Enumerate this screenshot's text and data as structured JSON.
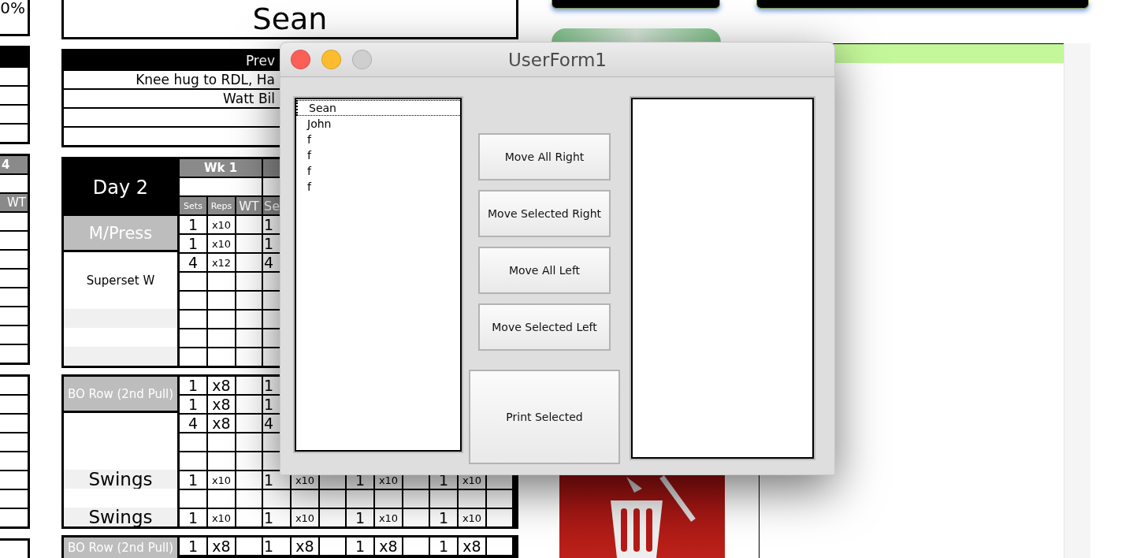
{
  "sheet": {
    "left": {
      "summary": "0%",
      "week_header": "4",
      "column": "WT"
    },
    "name_title": "Sean",
    "preview": {
      "header": "Prev",
      "lines": [
        "Knee hug to RDL, Ha",
        "Watt Bil"
      ]
    },
    "blocks": [
      {
        "header": {
          "title": "Day 2",
          "weeks": [
            "Wk 1"
          ],
          "columns": [
            "Sets",
            "Reps",
            "WT",
            "Se"
          ]
        },
        "labels": [
          {
            "kind": "exercise",
            "text": "M/Press"
          },
          {
            "kind": "note",
            "text": "Superset W"
          },
          {
            "kind": "stripe"
          },
          {
            "kind": "blank"
          },
          {
            "kind": "stripe"
          }
        ],
        "rows": [
          {
            "groups": [
              {
                "sets": "1",
                "reps": "x10"
              },
              {
                "sets": "1"
              }
            ]
          },
          {
            "groups": [
              {
                "sets": "1",
                "reps": "x10"
              },
              {
                "sets": "1"
              }
            ]
          },
          {
            "groups": [
              {
                "sets": "4",
                "reps": "x12"
              },
              {
                "sets": "4"
              }
            ]
          },
          {},
          {},
          {},
          {},
          {}
        ]
      },
      {
        "labels": [
          {
            "kind": "exercise",
            "text": "BO Row (2nd Pull)"
          },
          {
            "kind": "note"
          },
          {
            "kind": "stripe",
            "text": "Swings"
          },
          {
            "kind": "blank"
          },
          {
            "kind": "stripe",
            "text": "Swings"
          }
        ],
        "rows": [
          {
            "groups": [
              {
                "sets": "1",
                "reps": "x8"
              },
              {
                "sets": "1"
              }
            ]
          },
          {
            "groups": [
              {
                "sets": "1",
                "reps": "x8"
              },
              {
                "sets": "1"
              }
            ]
          },
          {
            "groups": [
              {
                "sets": "4",
                "reps": "x8"
              },
              {
                "sets": "4"
              }
            ]
          },
          {},
          {},
          {
            "groups": [
              {
                "sets": "1",
                "reps": "x10"
              },
              {
                "sets": "1",
                "reps": "x10"
              },
              {
                "sets": "1",
                "reps": "x10"
              },
              {
                "sets": "1",
                "reps": "x10"
              }
            ]
          },
          {},
          {
            "groups": [
              {
                "sets": "1",
                "reps": "x10"
              },
              {
                "sets": "1",
                "reps": "x10"
              },
              {
                "sets": "1",
                "reps": "x10"
              },
              {
                "sets": "1",
                "reps": "x10"
              }
            ]
          }
        ]
      },
      {
        "labels": [
          {
            "kind": "exercise",
            "text": "BO Row (2nd Pull)"
          }
        ],
        "rows": [
          {
            "groups": [
              {
                "sets": "1",
                "reps": "x8"
              },
              {
                "sets": "1",
                "reps": "x8"
              },
              {
                "sets": "1",
                "reps": "x8"
              },
              {
                "sets": "1",
                "reps": "x8"
              }
            ]
          }
        ]
      }
    ]
  },
  "dialog": {
    "title": "UserForm1",
    "left_list": [
      {
        "label": "Sean",
        "selected": true
      },
      {
        "label": "John",
        "selected": false
      },
      {
        "label": "f",
        "selected": false
      },
      {
        "label": "f",
        "selected": false
      },
      {
        "label": "f",
        "selected": false
      },
      {
        "label": "f",
        "selected": false
      }
    ],
    "buttons": [
      "Move All Right",
      "Move Selected Right",
      "Move All Left",
      "Move Selected Left"
    ],
    "print_button": "Print Selected"
  }
}
